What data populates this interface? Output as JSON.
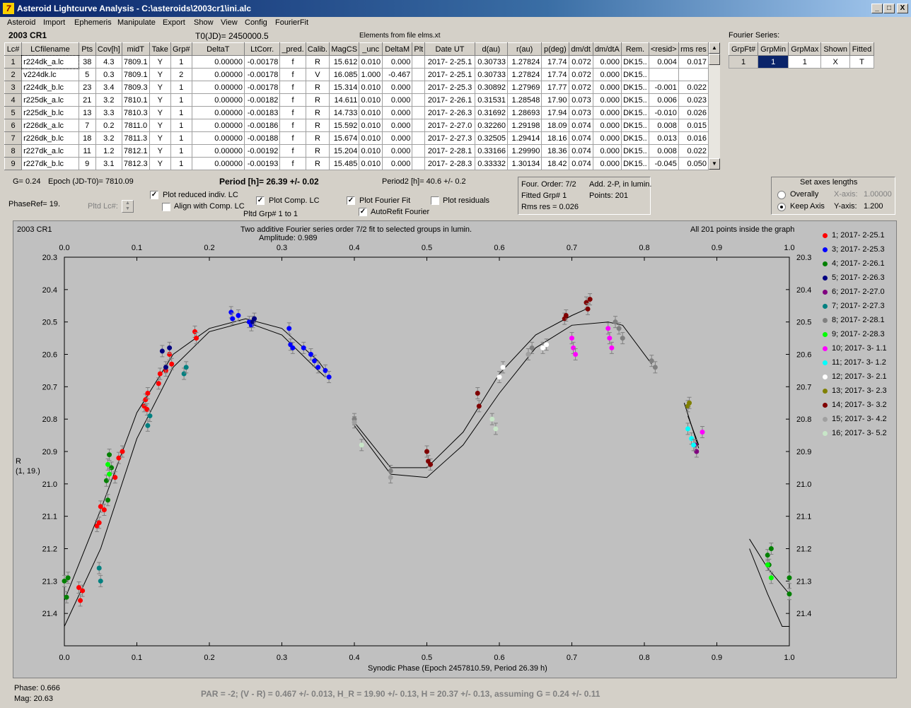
{
  "window": {
    "title": "Asteroid Lightcurve Analysis - C:\\asteroids\\2003cr1\\ini.alc",
    "minimize": "_",
    "maximize": "□",
    "close": "X"
  },
  "menu": [
    "Asteroid",
    "Import",
    "Ephemeris",
    "Manipulate",
    "Export",
    "Show",
    "View",
    "Config",
    "FourierFit"
  ],
  "header": {
    "asteroid": "2003 CR1",
    "t0": "T0(JD)= 2450000.5",
    "elements": "Elements from file elms.xt"
  },
  "lc_table": {
    "columns": [
      "Lc#",
      "LCfilename",
      "Pts",
      "Cov[h]",
      "midT",
      "Take",
      "Grp#",
      "DeltaT",
      "LtCorr.",
      "_pred.",
      "Calib.",
      "MagCS",
      "_unc",
      "DeltaM",
      "Plt",
      "Date UT",
      "d(au)",
      "r(au)",
      "p(deg)",
      "dm/dt",
      "dm/dtA",
      "Rem.",
      "<resid>",
      "rms res"
    ],
    "rows": [
      [
        "1",
        "r224dk_a.lc",
        "38",
        "4.3",
        "7809.1",
        "Y",
        "1",
        "0.00000",
        "-0.00178",
        "f",
        "R",
        "15.612",
        "0.010",
        "0.000",
        "",
        "2017- 2-25.1",
        "0.30733",
        "1.27824",
        "17.74",
        "0.072",
        "0.000",
        "DK15..",
        "0.004",
        "0.017"
      ],
      [
        "2",
        "v224dk.lc",
        "5",
        "0.3",
        "7809.1",
        "Y",
        "2",
        "0.00000",
        "-0.00178",
        "f",
        "V",
        "16.085",
        "1.000",
        "-0.467",
        "",
        "2017- 2-25.1",
        "0.30733",
        "1.27824",
        "17.74",
        "0.072",
        "0.000",
        "DK15..",
        "",
        ""
      ],
      [
        "3",
        "r224dk_b.lc",
        "23",
        "3.4",
        "7809.3",
        "Y",
        "1",
        "0.00000",
        "-0.00178",
        "f",
        "R",
        "15.314",
        "0.010",
        "0.000",
        "",
        "2017- 2-25.3",
        "0.30892",
        "1.27969",
        "17.77",
        "0.072",
        "0.000",
        "DK15..",
        "-0.001",
        "0.022"
      ],
      [
        "4",
        "r225dk_a.lc",
        "21",
        "3.2",
        "7810.1",
        "Y",
        "1",
        "0.00000",
        "-0.00182",
        "f",
        "R",
        "14.611",
        "0.010",
        "0.000",
        "",
        "2017- 2-26.1",
        "0.31531",
        "1.28548",
        "17.90",
        "0.073",
        "0.000",
        "DK15..",
        "0.006",
        "0.023"
      ],
      [
        "5",
        "r225dk_b.lc",
        "13",
        "3.3",
        "7810.3",
        "Y",
        "1",
        "0.00000",
        "-0.00183",
        "f",
        "R",
        "14.733",
        "0.010",
        "0.000",
        "",
        "2017- 2-26.3",
        "0.31692",
        "1.28693",
        "17.94",
        "0.073",
        "0.000",
        "DK15..",
        "-0.010",
        "0.026"
      ],
      [
        "6",
        "r226dk_a.lc",
        "7",
        "0.2",
        "7811.0",
        "Y",
        "1",
        "0.00000",
        "-0.00186",
        "f",
        "R",
        "15.592",
        "0.010",
        "0.000",
        "",
        "2017- 2-27.0",
        "0.32260",
        "1.29198",
        "18.09",
        "0.074",
        "0.000",
        "DK15..",
        "0.008",
        "0.015"
      ],
      [
        "7",
        "r226dk_b.lc",
        "18",
        "3.2",
        "7811.3",
        "Y",
        "1",
        "0.00000",
        "-0.00188",
        "f",
        "R",
        "15.674",
        "0.010",
        "0.000",
        "",
        "2017- 2-27.3",
        "0.32505",
        "1.29414",
        "18.16",
        "0.074",
        "0.000",
        "DK15..",
        "0.013",
        "0.016"
      ],
      [
        "8",
        "r227dk_a.lc",
        "11",
        "1.2",
        "7812.1",
        "Y",
        "1",
        "0.00000",
        "-0.00192",
        "f",
        "R",
        "15.204",
        "0.010",
        "0.000",
        "",
        "2017- 2-28.1",
        "0.33166",
        "1.29990",
        "18.36",
        "0.074",
        "0.000",
        "DK15..",
        "0.008",
        "0.022"
      ],
      [
        "9",
        "r227dk_b.lc",
        "9",
        "3.1",
        "7812.3",
        "Y",
        "1",
        "0.00000",
        "-0.00193",
        "f",
        "R",
        "15.485",
        "0.010",
        "0.000",
        "",
        "2017- 2-28.3",
        "0.33332",
        "1.30134",
        "18.42",
        "0.074",
        "0.000",
        "DK15..",
        "-0.045",
        "0.050"
      ]
    ]
  },
  "fourier_series": {
    "label": "Fourier Series:",
    "columns": [
      "GrpFt#",
      "GrpMin",
      "GrpMax",
      "Shown",
      "Fitted"
    ],
    "row": [
      "1",
      "1",
      "1",
      "X",
      "T"
    ]
  },
  "info": {
    "g": "G= 0.24",
    "epoch": "Epoch (JD-T0)= 7810.09",
    "period": "Period [h]= 26.39 +/- 0.02",
    "period2": "Period2 [h]= 40.6 +/- 0.2",
    "phaseref": "PhaseRef= 19.",
    "pltdlc": "Pltd Lc#:",
    "pltdgrp": "Pltd Grp#  1   to   1"
  },
  "options": {
    "plot_reduced": "Plot reduced indiv. LC",
    "align_comp": "Align with Comp. LC",
    "plot_comp": "Plot Comp. LC",
    "plot_fourier": "Plot Fourier Fit",
    "autorefit": "AutoRefit Fourier",
    "plot_residuals": "Plot residuals",
    "plot_reduced_checked": true,
    "align_comp_checked": false,
    "plot_comp_checked": true,
    "plot_fourier_checked": true,
    "autorefit_checked": true,
    "plot_residuals_checked": false
  },
  "fit_info": {
    "order": "Four. Order:  7/2",
    "add": "Add. 2-P, in lumin.",
    "grp": "Fitted Grp# 1",
    "points": "Points: 201",
    "rms": "Rms res     = 0.026"
  },
  "axes_lengths": {
    "title": "Set axes lengths",
    "overally": "Overally",
    "keep_axis": "Keep Axis",
    "xaxis_label": "X-axis:",
    "xaxis_value": "1.00000",
    "yaxis_label": "Y-axis:",
    "yaxis_value": "1.200",
    "selected": "Keep Axis"
  },
  "plot": {
    "name": "2003 CR1",
    "title1": "Two additive Fourier series order 7/2 fit to selected groups in lumin.",
    "title2": "Amplitude: 0.989",
    "points_note": "All 201 points inside the graph",
    "ylabel1": "R",
    "ylabel2": "(1, 19.)",
    "xlabel": "Synodic Phase (Epoch 2457810.59, Period 26.39 h)",
    "xticks": [
      "0.0",
      "0.1",
      "0.2",
      "0.3",
      "0.4",
      "0.5",
      "0.6",
      "0.7",
      "0.8",
      "0.9",
      "1.0"
    ],
    "yticks": [
      "20.3",
      "20.4",
      "20.5",
      "20.6",
      "20.7",
      "20.8",
      "20.9",
      "21.0",
      "21.1",
      "21.2",
      "21.3",
      "21.4"
    ]
  },
  "chart_data": {
    "type": "scatter",
    "title": "Two additive Fourier series order 7/2 fit to selected groups in lumin.",
    "xlabel": "Synodic Phase (Epoch 2457810.59, Period 26.39 h)",
    "ylabel": "R",
    "xlim": [
      0,
      1
    ],
    "ylim": [
      20.3,
      21.5
    ],
    "y_inverted": true,
    "grid": false,
    "legend_position": "right",
    "series": [
      {
        "name": "1; 2017- 2-25.1",
        "color": "#ff0000",
        "points": [
          [
            0.02,
            21.32
          ],
          [
            0.022,
            21.36
          ],
          [
            0.025,
            21.33
          ],
          [
            0.045,
            21.13
          ],
          [
            0.048,
            21.12
          ],
          [
            0.05,
            21.07
          ],
          [
            0.055,
            21.08
          ],
          [
            0.07,
            20.98
          ],
          [
            0.075,
            20.92
          ],
          [
            0.08,
            20.9
          ],
          [
            0.11,
            20.76
          ],
          [
            0.112,
            20.74
          ],
          [
            0.114,
            20.77
          ],
          [
            0.115,
            20.72
          ],
          [
            0.13,
            20.69
          ],
          [
            0.132,
            20.66
          ],
          [
            0.14,
            20.65
          ],
          [
            0.145,
            20.6
          ],
          [
            0.148,
            20.63
          ],
          [
            0.18,
            20.53
          ],
          [
            0.182,
            20.55
          ]
        ]
      },
      {
        "name": "3; 2017- 2-25.3",
        "color": "#0000ff",
        "points": [
          [
            0.23,
            20.47
          ],
          [
            0.232,
            20.49
          ],
          [
            0.24,
            20.48
          ],
          [
            0.255,
            20.5
          ],
          [
            0.258,
            20.51
          ],
          [
            0.31,
            20.52
          ],
          [
            0.312,
            20.57
          ],
          [
            0.315,
            20.58
          ],
          [
            0.33,
            20.58
          ],
          [
            0.34,
            20.6
          ],
          [
            0.345,
            20.62
          ],
          [
            0.35,
            20.64
          ],
          [
            0.36,
            20.65
          ],
          [
            0.365,
            20.67
          ]
        ]
      },
      {
        "name": "4; 2017- 2-26.1",
        "color": "#008000",
        "points": [
          [
            0.0,
            21.3
          ],
          [
            0.005,
            21.29
          ],
          [
            0.003,
            21.35
          ],
          [
            0.06,
            21.05
          ],
          [
            0.058,
            20.99
          ],
          [
            0.062,
            20.91
          ],
          [
            0.065,
            20.95
          ],
          [
            0.97,
            21.22
          ],
          [
            0.972,
            21.25
          ],
          [
            0.975,
            21.2
          ],
          [
            1.0,
            21.29
          ],
          [
            1.0,
            21.34
          ]
        ]
      },
      {
        "name": "5; 2017- 2-26.3",
        "color": "#000080",
        "points": [
          [
            0.135,
            20.59
          ],
          [
            0.14,
            20.64
          ],
          [
            0.145,
            20.58
          ],
          [
            0.26,
            20.5
          ],
          [
            0.262,
            20.49
          ]
        ]
      },
      {
        "name": "6; 2017- 2-27.0",
        "color": "#800080",
        "points": [
          [
            0.87,
            20.88
          ],
          [
            0.872,
            20.9
          ]
        ]
      },
      {
        "name": "7; 2017- 2-27.3",
        "color": "#008080",
        "points": [
          [
            0.048,
            21.26
          ],
          [
            0.05,
            21.3
          ],
          [
            0.115,
            20.82
          ],
          [
            0.118,
            20.79
          ],
          [
            0.165,
            20.66
          ],
          [
            0.168,
            20.64
          ]
        ]
      },
      {
        "name": "8; 2017- 2-28.1",
        "color": "#808080",
        "points": [
          [
            0.76,
            20.5
          ],
          [
            0.765,
            20.52
          ],
          [
            0.77,
            20.55
          ],
          [
            0.81,
            20.62
          ],
          [
            0.815,
            20.64
          ],
          [
            0.4,
            20.8
          ],
          [
            0.45,
            20.96
          ],
          [
            0.64,
            20.6
          ],
          [
            0.645,
            20.58
          ]
        ]
      },
      {
        "name": "9; 2017- 2-28.3",
        "color": "#00ff00",
        "points": [
          [
            0.06,
            20.94
          ],
          [
            0.062,
            20.97
          ],
          [
            0.97,
            21.25
          ],
          [
            0.975,
            21.29
          ]
        ]
      },
      {
        "name": "10; 2017- 3- 1.1",
        "color": "#ff00ff",
        "points": [
          [
            0.7,
            20.55
          ],
          [
            0.702,
            20.58
          ],
          [
            0.705,
            20.6
          ],
          [
            0.75,
            20.52
          ],
          [
            0.752,
            20.55
          ],
          [
            0.755,
            20.58
          ],
          [
            0.88,
            20.84
          ]
        ]
      },
      {
        "name": "11; 2017- 3- 1.2",
        "color": "#00ffff",
        "points": [
          [
            0.86,
            20.83
          ],
          [
            0.865,
            20.86
          ],
          [
            0.868,
            20.88
          ]
        ]
      },
      {
        "name": "12; 2017- 3- 2.1",
        "color": "#ffffff",
        "points": [
          [
            0.6,
            20.67
          ],
          [
            0.605,
            20.64
          ],
          [
            0.66,
            20.58
          ],
          [
            0.665,
            20.57
          ]
        ]
      },
      {
        "name": "13; 2017- 3- 2.3",
        "color": "#808000",
        "points": [
          [
            0.86,
            20.76
          ],
          [
            0.862,
            20.75
          ]
        ]
      },
      {
        "name": "14; 2017- 3- 3.2",
        "color": "#800000",
        "points": [
          [
            0.5,
            20.9
          ],
          [
            0.502,
            20.93
          ],
          [
            0.505,
            20.94
          ],
          [
            0.57,
            20.72
          ],
          [
            0.572,
            20.76
          ],
          [
            0.69,
            20.49
          ],
          [
            0.692,
            20.48
          ],
          [
            0.72,
            20.44
          ],
          [
            0.722,
            20.46
          ],
          [
            0.725,
            20.43
          ]
        ]
      },
      {
        "name": "15; 2017- 3- 4.2",
        "color": "#a0a0a0",
        "points": [
          [
            0.4,
            20.81
          ],
          [
            0.45,
            20.98
          ],
          [
            0.64,
            20.6
          ]
        ]
      },
      {
        "name": "16; 2017- 3- 5.2",
        "color": "#c8e6c8",
        "points": [
          [
            0.41,
            20.88
          ],
          [
            0.59,
            20.8
          ],
          [
            0.595,
            20.83
          ]
        ]
      }
    ]
  },
  "status": {
    "phase": "Phase:  0.666",
    "mag": "Mag:     20.63",
    "par": "PAR = -2; (V - R) = 0.467 +/- 0.013, H_R = 19.90 +/- 0.13, H = 20.37 +/- 0.13, assuming G = 0.24 +/- 0.11"
  }
}
